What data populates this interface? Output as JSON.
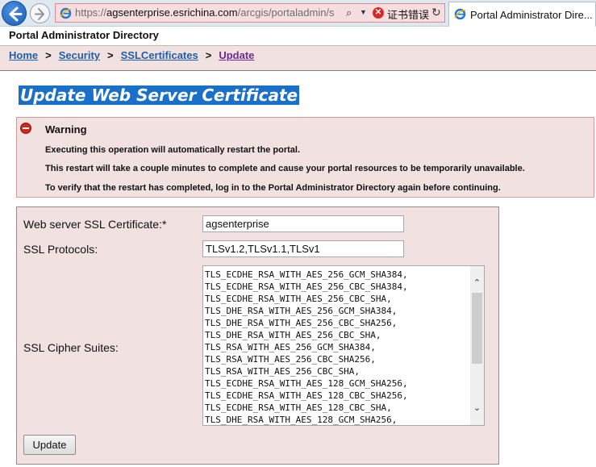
{
  "browser": {
    "url_prefix": "https://",
    "url_host": "agsenterprise.esrichina.com",
    "url_path": "/arcgis/portaladmin/s",
    "search_glyph": "⌕",
    "dropdown_glyph": "▼",
    "cert_error_glyph": "✕",
    "cert_error_text": "证书错误",
    "refresh_glyph": "↻",
    "tab_title": "Portal Administrator Dire..."
  },
  "site": {
    "title": "Portal Administrator Directory"
  },
  "breadcrumb": {
    "items": [
      "Home",
      "Security",
      "SSLCertificates",
      "Update"
    ],
    "separator": ">"
  },
  "page": {
    "heading": "Update Web Server Certificate"
  },
  "warning": {
    "title": "Warning",
    "lines": [
      "Executing this operation will automatically restart the portal.",
      "This restart will take a couple minutes to complete and cause your portal resources to be temporarily unavailable.",
      "To verify that the restart has completed, log in to the Portal Administrator Directory again before continuing."
    ]
  },
  "form": {
    "cert_label": "Web server SSL Certificate:*",
    "cert_value": "agsenterprise",
    "protocols_label": "SSL Protocols:",
    "protocols_value": "TLSv1.2,TLSv1.1,TLSv1",
    "ciphers_label": "SSL Cipher Suites:",
    "cipher_lines": [
      "TLS_ECDHE_RSA_WITH_AES_256_GCM_SHA384,",
      "TLS_ECDHE_RSA_WITH_AES_256_CBC_SHA384,",
      "TLS_ECDHE_RSA_WITH_AES_256_CBC_SHA,",
      "TLS_DHE_RSA_WITH_AES_256_GCM_SHA384,",
      "TLS_DHE_RSA_WITH_AES_256_CBC_SHA256,",
      "TLS_DHE_RSA_WITH_AES_256_CBC_SHA,",
      "TLS_RSA_WITH_AES_256_GCM_SHA384,",
      "TLS_RSA_WITH_AES_256_CBC_SHA256,",
      "TLS_RSA_WITH_AES_256_CBC_SHA,",
      "TLS_ECDHE_RSA_WITH_AES_128_GCM_SHA256,",
      "TLS_ECDHE_RSA_WITH_AES_128_CBC_SHA256,",
      "TLS_ECDHE_RSA_WITH_AES_128_CBC_SHA,",
      "TLS_DHE_RSA_WITH_AES_128_GCM_SHA256,"
    ],
    "scroll_up_glyph": "⌃",
    "scroll_down_glyph": "⌄",
    "submit_label": "Update"
  },
  "colors": {
    "accent": "#1a6fc9",
    "panel_bg": "#f2e1e1",
    "link": "#1f5ea8",
    "visited_link": "#6a2a8e",
    "error": "#d02a1f"
  },
  "icons": {
    "back": "back-arrow-icon",
    "forward": "forward-arrow-icon",
    "site": "ie-logo-icon",
    "warning": "stop-warning-icon"
  }
}
